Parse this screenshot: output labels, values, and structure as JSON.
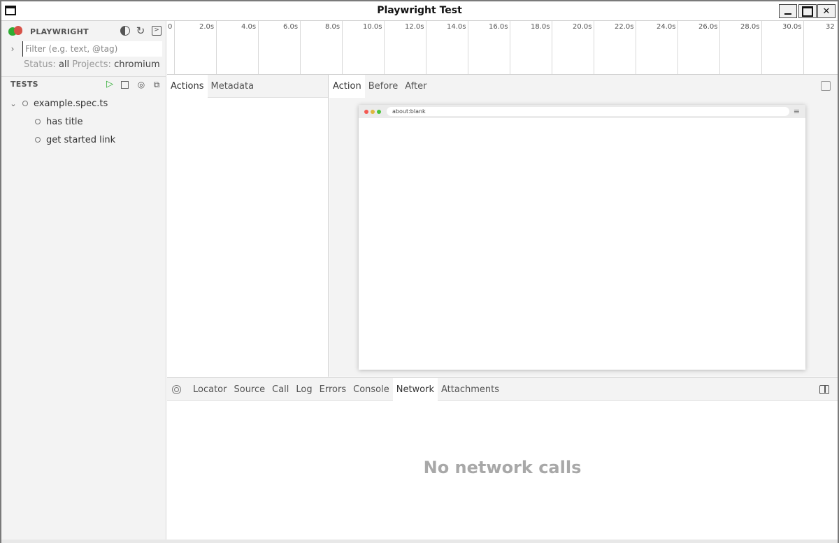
{
  "window": {
    "title": "Playwright Test"
  },
  "sidebar": {
    "brand": "PLAYWRIGHT",
    "filter_placeholder": "Filter (e.g. text, @tag)",
    "status_label": "Status:",
    "status_value": "all",
    "projects_label": "Projects:",
    "projects_value": "chromium",
    "tests_header": "TESTS",
    "tree": {
      "file": "example.spec.ts",
      "tests": [
        "has title",
        "get started link"
      ]
    }
  },
  "timeline": {
    "ticks": [
      "0",
      "2.0s",
      "4.0s",
      "6.0s",
      "8.0s",
      "10.0s",
      "12.0s",
      "14.0s",
      "16.0s",
      "18.0s",
      "20.0s",
      "22.0s",
      "24.0s",
      "26.0s",
      "28.0s",
      "30.0s",
      "32"
    ]
  },
  "actions_panel": {
    "tabs": [
      "Actions",
      "Metadata"
    ]
  },
  "snapshot_panel": {
    "tabs": [
      "Action",
      "Before",
      "After"
    ],
    "url": "about:blank",
    "traffic_light_colors": [
      "#f45952",
      "#dfb73e",
      "#4ac33d"
    ]
  },
  "bottom_panel": {
    "tabs": [
      "Locator",
      "Source",
      "Call",
      "Log",
      "Errors",
      "Console",
      "Network",
      "Attachments"
    ],
    "active_tab": "Network",
    "empty_message": "No network calls"
  }
}
